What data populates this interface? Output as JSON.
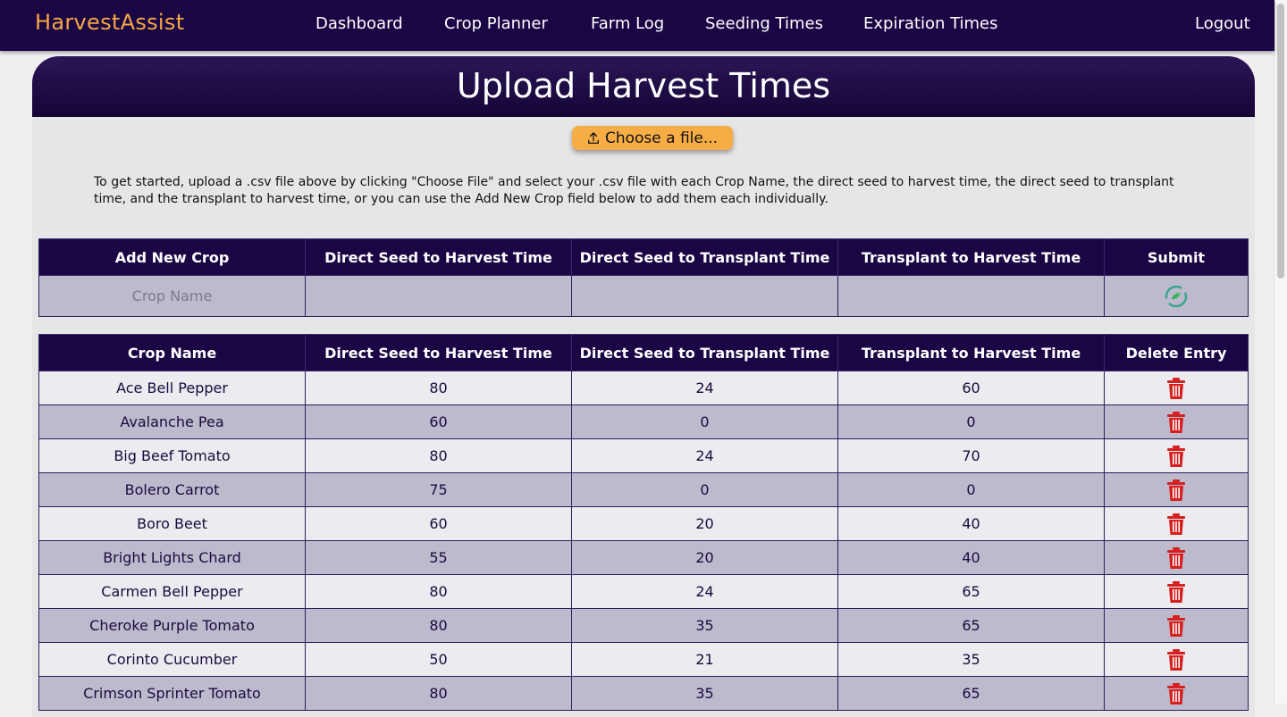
{
  "nav": {
    "brand": "HarvestAssist",
    "links": [
      "Dashboard",
      "Crop Planner",
      "Farm Log",
      "Seeding Times",
      "Expiration Times"
    ],
    "logout": "Logout"
  },
  "page": {
    "title": "Upload Harvest Times",
    "upload_label": "Choose a file...",
    "instructions": "To get started, upload a .csv file above by clicking \"Choose File\" and select your .csv file with each Crop Name, the direct seed to harvest time, the direct seed to transplant time, and the transplant to harvest time, or you can use the Add New Crop field below to add them each individually."
  },
  "add_form": {
    "headers": [
      "Add New Crop",
      "Direct Seed to Harvest Time",
      "Direct Seed to Transplant Time",
      "Transplant to Harvest Time",
      "Submit"
    ],
    "crop_name_placeholder": "Crop Name",
    "direct_seed_to_harvest": "",
    "direct_seed_to_transplant": "",
    "transplant_to_harvest": ""
  },
  "crops_table": {
    "headers": [
      "Crop Name",
      "Direct Seed to Harvest Time",
      "Direct Seed to Transplant Time",
      "Transplant to Harvest Time",
      "Delete Entry"
    ],
    "rows": [
      [
        "Ace Bell Pepper",
        "80",
        "24",
        "60"
      ],
      [
        "Avalanche Pea",
        "60",
        "0",
        "0"
      ],
      [
        "Big Beef Tomato",
        "80",
        "24",
        "70"
      ],
      [
        "Bolero Carrot",
        "75",
        "0",
        "0"
      ],
      [
        "Boro Beet",
        "60",
        "20",
        "40"
      ],
      [
        "Bright Lights Chard",
        "55",
        "20",
        "40"
      ],
      [
        "Carmen Bell Pepper",
        "80",
        "24",
        "65"
      ],
      [
        "Cheroke Purple Tomato",
        "80",
        "35",
        "65"
      ],
      [
        "Corinto Cucumber",
        "50",
        "21",
        "35"
      ],
      [
        "Crimson Sprinter Tomato",
        "80",
        "35",
        "65"
      ]
    ]
  },
  "icons": {
    "upload": "upload-icon",
    "submit": "submit-leaf-icon",
    "delete": "trash-icon"
  },
  "colors": {
    "nav_bg": "#1a0644",
    "brand": "#f5a742",
    "upload_button": "#f7ad45",
    "row_alt": "#bebacd",
    "delete_icon": "#d62020"
  }
}
